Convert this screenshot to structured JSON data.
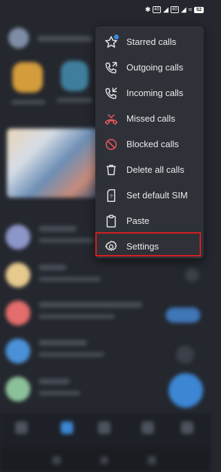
{
  "status_bar": {
    "time": "",
    "battery": "52"
  },
  "menu": {
    "items": [
      {
        "label": "Starred calls",
        "icon": "star-icon"
      },
      {
        "label": "Outgoing calls",
        "icon": "outgoing-call-icon"
      },
      {
        "label": "Incoming calls",
        "icon": "incoming-call-icon"
      },
      {
        "label": "Missed calls",
        "icon": "missed-call-icon"
      },
      {
        "label": "Blocked calls",
        "icon": "blocked-icon"
      },
      {
        "label": "Delete all calls",
        "icon": "trash-icon"
      },
      {
        "label": "Set default SIM",
        "icon": "sim-question-icon"
      },
      {
        "label": "Paste",
        "icon": "clipboard-icon"
      },
      {
        "label": "Settings",
        "icon": "gear-icon"
      }
    ],
    "highlighted_item": "Settings"
  },
  "colors": {
    "background": "#24272e",
    "menu_background": "#2e3138",
    "highlight_border": "#d91e1e",
    "missed_call": "#e0555c",
    "blocked": "#e0555c",
    "accent": "#3c86d4"
  }
}
